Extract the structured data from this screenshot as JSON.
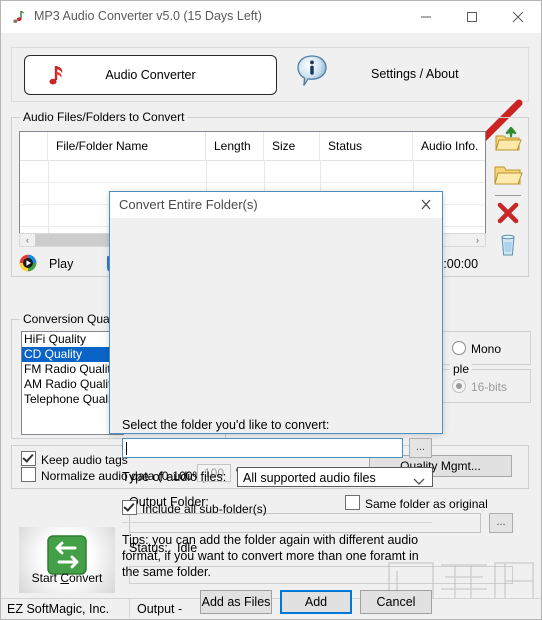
{
  "window": {
    "title": "MP3 Audio Converter v5.0 (15 Days Left)",
    "icon": "app-music-icon",
    "minimize": "─",
    "maximize": "□",
    "close": "✕"
  },
  "toolbar": {
    "audio_converter_label": "Audio Converter",
    "note_icon": "music-note-icon",
    "info_icon": "info-balloon-icon",
    "settings_label": "Settings / About"
  },
  "files_group": {
    "caption": "Audio Files/Folders to Convert",
    "columns": [
      "File/Folder Name",
      "Length",
      "Size",
      "Status",
      "Audio Info."
    ],
    "rows": [],
    "scroll_left": "‹",
    "scroll_right": "›"
  },
  "side_icons": [
    {
      "name": "add-folder-up-icon",
      "tooltip": "Add Files"
    },
    {
      "name": "open-folder-icon",
      "tooltip": "Convert Entire Folder(s)"
    },
    {
      "name": "remove-x-icon",
      "tooltip": "Remove"
    },
    {
      "name": "clear-trash-icon",
      "tooltip": "Clear List"
    }
  ],
  "player": {
    "play_icon": "play-circle-icon",
    "play_label": "Play",
    "volume_value": 0,
    "timecode": "0 / 0:00:00"
  },
  "quality_group": {
    "caption": "Conversion Quality",
    "items": [
      "HiFi Quality",
      "CD Quality",
      "FM Radio Quality",
      "AM Radio Quality",
      "Telephone Quality"
    ],
    "selected_index": 1
  },
  "channels_group": {
    "caption": "",
    "mono_label": "Mono",
    "mono_checked": false
  },
  "sample_group": {
    "caption": "ple",
    "bits_label": "16-bits",
    "bits_checked": true
  },
  "tags_group": {
    "keep_tags_label": "Keep audio tags",
    "keep_tags_checked": true,
    "normalize_label": "Normalize audio data (0-100%):",
    "normalize_checked": false,
    "normalize_value": "100",
    "percent_symbol": "%",
    "quality_mgmt_label": "Quality Mgmt...",
    "quality_mgmt_accel": "Q"
  },
  "output": {
    "folder_label": "Output Folder:",
    "folder_value": "",
    "browse_label": "...",
    "same_folder_label": "Same folder as original",
    "same_folder_checked": false,
    "status_label": "Status:",
    "status_value": "Idle",
    "progress_percent": 0
  },
  "start_button": {
    "label_prefix": "Start ",
    "label_accel": "C",
    "label_suffix": "onvert",
    "icon": "convert-arrows-icon"
  },
  "status_bar": {
    "company": "EZ SoftMagic, Inc.",
    "output": "Output -"
  },
  "watermark": {
    "text": "www.xiazaiba.com"
  },
  "dialog": {
    "title": "Convert Entire Folder(s)",
    "close_icon": "✕",
    "folder_prompt": "Select the folder you'd like to convert:",
    "folder_value": "",
    "folder_placeholder": "",
    "browse_label": "...",
    "type_label": "Type of audio files:",
    "type_selected": "All supported audio files",
    "type_options": [
      "All supported audio files"
    ],
    "include_sub_label": "Include all sub-folder(s)",
    "include_sub_checked": true,
    "tips": "Tips: you can add the folder again with different audio format, if you want to convert more than one foramt in the same folder.",
    "buttons": {
      "add_as_files": "Add as Files",
      "add": "Add",
      "cancel": "Cancel"
    }
  },
  "colors": {
    "accent": "#0078d7",
    "selection": "#0a64c8",
    "dialog_border": "#4a8ec2",
    "arrow_red": "#cc2222",
    "start_green": "#3aa63a"
  }
}
